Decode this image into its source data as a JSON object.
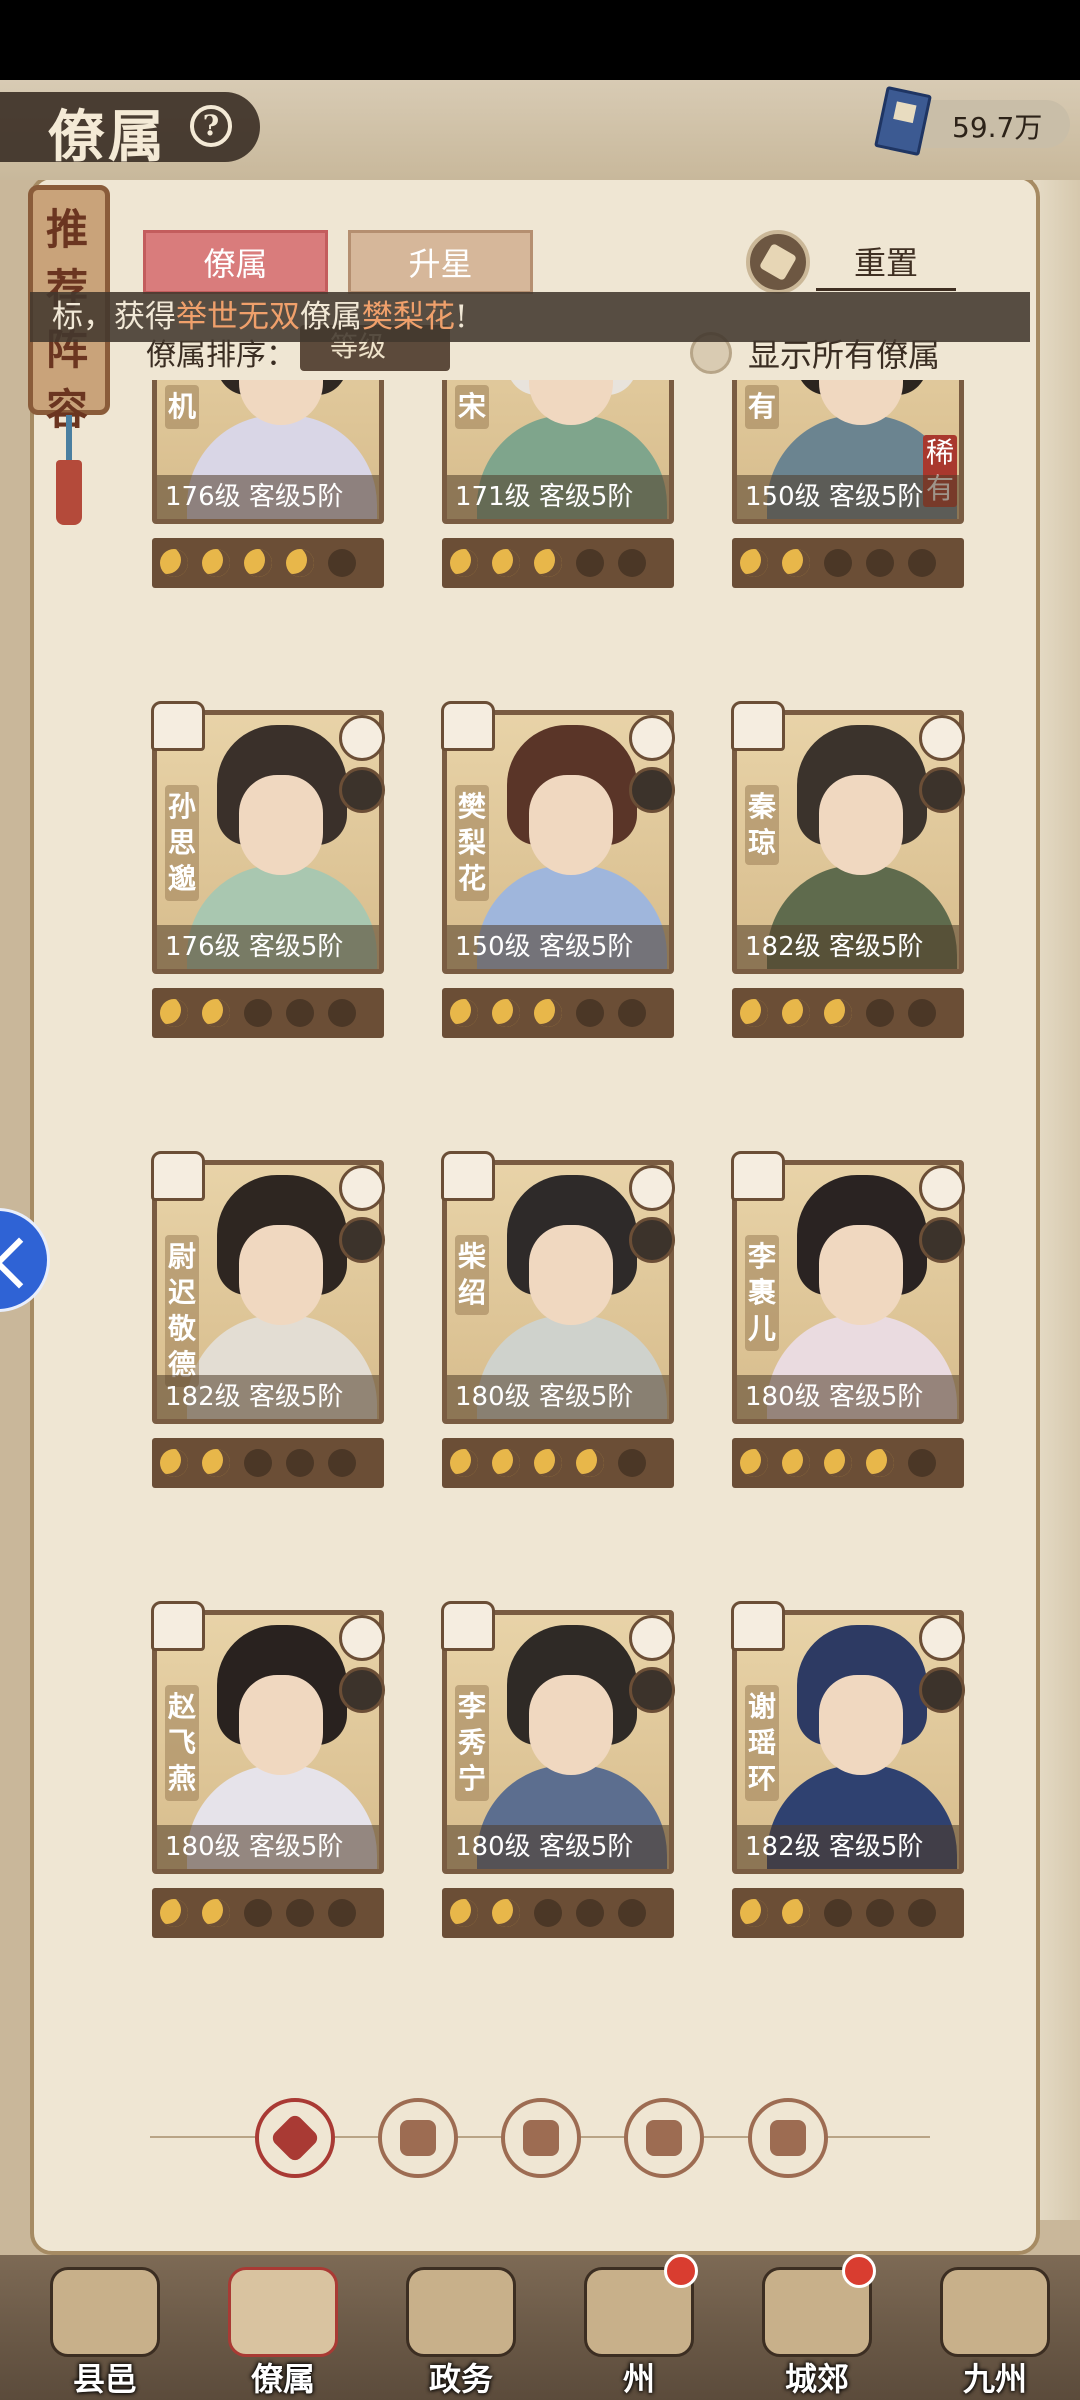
{
  "header": {
    "title": "僚属",
    "help_icon": "question-icon",
    "currency_icon": "book-icon",
    "currency_value": "59.7万"
  },
  "recommend_tag": {
    "label": "推荐阵容"
  },
  "tabs": [
    {
      "label": "僚属",
      "active": true
    },
    {
      "label": "升星",
      "active": false
    }
  ],
  "reset": {
    "icon": "refresh-icon",
    "label": "重置"
  },
  "sort": {
    "label": "僚属排序：",
    "value": "等级"
  },
  "show_all": {
    "label": "显示所有僚属",
    "checked": false
  },
  "notification": {
    "prefix": "标，获得",
    "highlight1": "举世无双",
    "middle": "僚属",
    "highlight2": "樊梨花",
    "suffix": "!"
  },
  "cards": [
    {
      "name": "机",
      "level": "176级",
      "rank": "客级5阶",
      "stars_on": 4,
      "rare": "",
      "hair": "#2e2722",
      "cloth": "#d9d6e6"
    },
    {
      "name": "宋",
      "level": "171级",
      "rank": "客级5阶",
      "stars_on": 3,
      "rare": "",
      "hair": "#e8e3dc",
      "cloth": "#7fa58c"
    },
    {
      "name": "有",
      "level": "150级",
      "rank": "客级5阶",
      "stars_on": 2,
      "rare": "稀有",
      "hair": "#2b241f",
      "cloth": "#6b8490"
    },
    {
      "name": "孙思邈",
      "level": "176级",
      "rank": "客级5阶",
      "stars_on": 2,
      "rare": "",
      "hair": "#3a302a",
      "cloth": "#a9c7b0"
    },
    {
      "name": "樊梨花",
      "level": "150级",
      "rank": "客级5阶",
      "stars_on": 3,
      "rare": "",
      "hair": "#5a3528",
      "cloth": "#9fb6dc"
    },
    {
      "name": "秦琼",
      "level": "182级",
      "rank": "客级5阶",
      "stars_on": 3,
      "rare": "",
      "hair": "#3b332c",
      "cloth": "#5f6b4d"
    },
    {
      "name": "尉迟敬德",
      "level": "182级",
      "rank": "客级5阶",
      "stars_on": 2,
      "rare": "",
      "hair": "#2e2621",
      "cloth": "#e3ddd3"
    },
    {
      "name": "柴绍",
      "level": "180级",
      "rank": "客级5阶",
      "stars_on": 4,
      "rare": "",
      "hair": "#2e2a29",
      "cloth": "#cfd2cc"
    },
    {
      "name": "李裹儿",
      "level": "180级",
      "rank": "客级5阶",
      "stars_on": 4,
      "rare": "",
      "hair": "#2a2322",
      "cloth": "#eadbe0"
    },
    {
      "name": "赵飞燕",
      "level": "180级",
      "rank": "客级5阶",
      "stars_on": 2,
      "rare": "",
      "hair": "#29221f",
      "cloth": "#e6e3ea"
    },
    {
      "name": "李秀宁",
      "level": "180级",
      "rank": "客级5阶",
      "stars_on": 2,
      "rare": "",
      "hair": "#2f2a26",
      "cloth": "#5c6e8f"
    },
    {
      "name": "谢瑶环",
      "level": "182级",
      "rank": "客级5阶",
      "stars_on": 2,
      "rare": "",
      "hair": "#2d3a63",
      "cloth": "#2f4170"
    }
  ],
  "filters": [
    {
      "icon": "all-diamond-icon",
      "active": true
    },
    {
      "icon": "faction-bell-icon",
      "active": false
    },
    {
      "icon": "faction-beast-icon",
      "active": false
    },
    {
      "icon": "faction-fan-icon",
      "active": false
    },
    {
      "icon": "faction-lion-icon",
      "active": false
    }
  ],
  "bottom_nav": [
    {
      "label": "县邑",
      "icon": "county-icon",
      "active": false,
      "badge": false
    },
    {
      "label": "僚属",
      "icon": "retainer-icon",
      "active": true,
      "badge": false
    },
    {
      "label": "政务",
      "icon": "affairs-icon",
      "active": false,
      "badge": false
    },
    {
      "label": "州",
      "icon": "prefecture-icon",
      "active": false,
      "badge": true
    },
    {
      "label": "城郊",
      "icon": "suburb-icon",
      "active": false,
      "badge": true
    },
    {
      "label": "九州",
      "icon": "map-scroll-icon",
      "active": false,
      "badge": false
    }
  ],
  "colors": {
    "accent_red": "#a93a34",
    "tab_active": "#d97c7c",
    "highlight_orange": "#f0a06b",
    "star_on": "#e8b74a"
  }
}
